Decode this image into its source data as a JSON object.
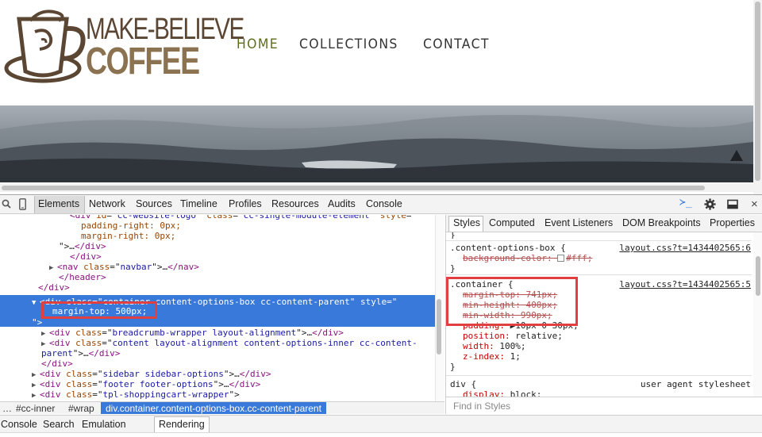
{
  "site": {
    "brand_line1": "MAKE-BELIEVE",
    "brand_line2": "COFFEE",
    "nav": [
      {
        "label": "HOME",
        "active": true
      },
      {
        "label": "COLLECTIONS",
        "active": false
      },
      {
        "label": "CONTACT",
        "active": false
      }
    ],
    "colors": {
      "brand_dark": "#5a4632",
      "brand_light": "#8b7352",
      "nav_active": "#5f6c1f"
    }
  },
  "devtools": {
    "tabs": [
      "Elements",
      "Network",
      "Sources",
      "Timeline",
      "Profiles",
      "Resources",
      "Audits",
      "Console"
    ],
    "active_tab": "Elements",
    "icons": {
      "search": "magnifier-icon",
      "device": "device-mode-icon",
      "drawer": "console-drawer-icon",
      "settings": "gear-icon",
      "dock": "dock-side-icon",
      "close": "close-icon"
    },
    "close_glyph": "×",
    "drawer_glyph": "≻_",
    "elements": {
      "lines": [
        {
          "parts": [
            [
              "tag",
              "<div "
            ],
            [
              "attr",
              "id"
            ],
            [
              "plain",
              "=\""
            ],
            [
              "val",
              "cc-website-logo"
            ],
            [
              "plain",
              "\" "
            ],
            [
              "attr",
              "class"
            ],
            [
              "plain",
              "=\""
            ],
            [
              "val",
              "cc-single-module-element"
            ],
            [
              "plain",
              "\" "
            ],
            [
              "attr",
              "style"
            ],
            [
              "plain",
              "=\""
            ]
          ]
        },
        {
          "parts": [
            [
              "attr",
              "padding-right: 0px;"
            ]
          ]
        },
        {
          "parts": [
            [
              "attr",
              "margin-right: 0px;"
            ]
          ]
        },
        {
          "parts": [
            [
              "plain",
              "\">"
            ],
            [
              "plain",
              "…"
            ],
            [
              "tag",
              "</div>"
            ]
          ]
        },
        {
          "parts": [
            [
              "tag",
              "</div>"
            ]
          ]
        },
        {
          "parts": [
            [
              "tri",
              "▶"
            ],
            [
              "tag",
              "<nav "
            ],
            [
              "attr",
              "class"
            ],
            [
              "plain",
              "=\""
            ],
            [
              "val",
              "navbar"
            ],
            [
              "plain",
              "\">"
            ],
            [
              "plain",
              "…"
            ],
            [
              "tag",
              "</nav>"
            ]
          ]
        },
        {
          "parts": [
            [
              "tag",
              "</header>"
            ]
          ]
        },
        {
          "parts": [
            [
              "tag",
              "</div>"
            ]
          ]
        },
        {
          "parts": [
            [
              "tri",
              "▼"
            ],
            [
              "tag",
              "<div "
            ],
            [
              "attr",
              "class"
            ],
            [
              "plain",
              "=\""
            ],
            [
              "val",
              "container content-options-box cc-content-parent"
            ],
            [
              "plain",
              "\" "
            ],
            [
              "attr",
              "style"
            ],
            [
              "plain",
              "=\""
            ]
          ]
        },
        {
          "parts": [
            [
              "attr",
              "margin-top: 500px;"
            ]
          ]
        },
        {
          "parts": [
            [
              "plain",
              "\">"
            ]
          ]
        },
        {
          "parts": [
            [
              "tri",
              "▶"
            ],
            [
              "tag",
              "<div "
            ],
            [
              "attr",
              "class"
            ],
            [
              "plain",
              "=\""
            ],
            [
              "val",
              "breadcrumb-wrapper layout-alignment"
            ],
            [
              "plain",
              "\">"
            ],
            [
              "plain",
              "…"
            ],
            [
              "tag",
              "</div>"
            ]
          ]
        },
        {
          "parts": [
            [
              "tri",
              "▶"
            ],
            [
              "tag",
              "<div "
            ],
            [
              "attr",
              "class"
            ],
            [
              "plain",
              "=\""
            ],
            [
              "val",
              "content layout-alignment content-options-inner cc-content-"
            ]
          ]
        },
        {
          "parts": [
            [
              "val",
              "parent"
            ],
            [
              "plain",
              "\">"
            ],
            [
              "plain",
              "…"
            ],
            [
              "tag",
              "</div>"
            ]
          ]
        },
        {
          "parts": [
            [
              "tag",
              "</div>"
            ]
          ]
        },
        {
          "parts": [
            [
              "tri",
              "▶"
            ],
            [
              "tag",
              "<div "
            ],
            [
              "attr",
              "class"
            ],
            [
              "plain",
              "=\""
            ],
            [
              "val",
              "sidebar sidebar-options"
            ],
            [
              "plain",
              "\">"
            ],
            [
              "plain",
              "…"
            ],
            [
              "tag",
              "</div>"
            ]
          ]
        },
        {
          "parts": [
            [
              "tri",
              "▶"
            ],
            [
              "tag",
              "<div "
            ],
            [
              "attr",
              "class"
            ],
            [
              "plain",
              "=\""
            ],
            [
              "val",
              "footer footer-options"
            ],
            [
              "plain",
              "\">"
            ],
            [
              "plain",
              "…"
            ],
            [
              "tag",
              "</div>"
            ]
          ]
        },
        {
          "parts": [
            [
              "tri",
              "▶"
            ],
            [
              "tag",
              "<div "
            ],
            [
              "attr",
              "class"
            ],
            [
              "plain",
              "=\""
            ],
            [
              "val",
              "tpl-shoppingcart-wrapper"
            ],
            [
              "plain",
              "\">"
            ]
          ]
        }
      ]
    },
    "breadcrumbs": [
      "…",
      "#cc-inner",
      "#wrap"
    ],
    "breadcrumb_active": "div.container.content-options-box.cc-content-parent",
    "styles": {
      "tabs": [
        "Styles",
        "Computed",
        "Event Listeners",
        "DOM Breakpoints",
        "Properties"
      ],
      "active_tab": "Styles",
      "top_brace": "}",
      "rule1": {
        "selector": ".content-options-box {",
        "source": "layout.css?t=1434402565:6",
        "props": [
          {
            "name": "background-color:",
            "value": "#fff;",
            "struck": true,
            "swatch": true
          }
        ],
        "close": "}"
      },
      "rule2": {
        "selector": ".container {",
        "source": "layout.css?t=1434402565:5",
        "props": [
          {
            "name": "margin-top:",
            "value": "741px;",
            "struck": true
          },
          {
            "name": "min-height:",
            "value": "400px;",
            "struck": true
          },
          {
            "name": "min-width:",
            "value": "990px;",
            "struck": true
          },
          {
            "name": "padding:",
            "value": "▶10px 0 30px;",
            "struck": false
          },
          {
            "name": "position:",
            "value": "relative;",
            "struck": false
          },
          {
            "name": "width:",
            "value": "100%;",
            "struck": false
          },
          {
            "name": "z-index:",
            "value": "1;",
            "struck": false
          }
        ],
        "close": "}"
      },
      "rule3": {
        "selector": "div {",
        "source": "user agent stylesheet",
        "props": [
          {
            "name": "display:",
            "value": "block;",
            "struck": false
          }
        ]
      },
      "find_placeholder": "Find in Styles"
    },
    "drawer_tabs": [
      "Console",
      "Search",
      "Emulation",
      "Rendering"
    ],
    "drawer_active": "Rendering",
    "highlight_color": "#3879d9",
    "annotation_color": "#e04040"
  }
}
